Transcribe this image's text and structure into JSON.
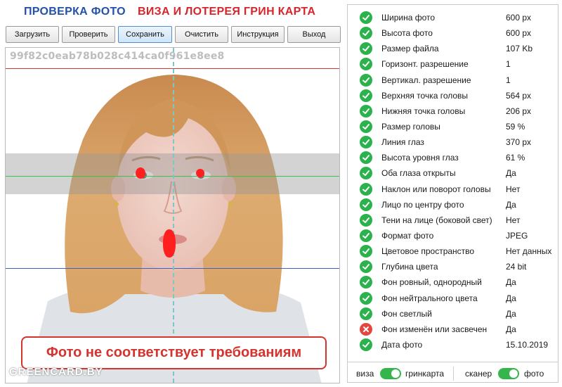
{
  "header": {
    "title_left": "ПРОВЕРКА ФОТО",
    "title_right": "ВИЗА И ЛОТЕРЕЯ ГРИН КАРТА"
  },
  "toolbar": {
    "buttons": [
      "Загрузить",
      "Проверить",
      "Сохранить",
      "Очистить",
      "Инструкция",
      "Выход"
    ],
    "active_button": "Сохранить"
  },
  "photo": {
    "hash": "99f82c0eab78b028c414ca0f961e8ee8",
    "result_message": "Фото не соответствует требованиям",
    "watermark": "GREENCARD.BY"
  },
  "checks": [
    {
      "label": "Ширина фото",
      "value": "600 px",
      "status": "ok"
    },
    {
      "label": "Высота фото",
      "value": "600 px",
      "status": "ok"
    },
    {
      "label": "Размер файла",
      "value": "107 Kb",
      "status": "ok"
    },
    {
      "label": "Горизонт. разрешение",
      "value": "1",
      "status": "ok"
    },
    {
      "label": "Вертикал. разрешение",
      "value": "1",
      "status": "ok"
    },
    {
      "label": "Верхняя точка головы",
      "value": "564 px",
      "status": "ok"
    },
    {
      "label": "Нижняя точка головы",
      "value": "206 px",
      "status": "ok"
    },
    {
      "label": "Размер головы",
      "value": "59 %",
      "status": "ok"
    },
    {
      "label": "Линия глаз",
      "value": "370 px",
      "status": "ok"
    },
    {
      "label": "Высота уровня глаз",
      "value": "61 %",
      "status": "ok"
    },
    {
      "label": "Оба глаза открыты",
      "value": "Да",
      "status": "ok"
    },
    {
      "label": "Наклон или поворот головы",
      "value": "Нет",
      "status": "ok"
    },
    {
      "label": "Лицо по центру фото",
      "value": "Да",
      "status": "ok"
    },
    {
      "label": "Тени на лице (боковой свет)",
      "value": "Нет",
      "status": "ok"
    },
    {
      "label": "Формат фото",
      "value": "JPEG",
      "status": "ok"
    },
    {
      "label": "Цветовое пространство",
      "value": "Нет данных",
      "status": "ok"
    },
    {
      "label": "Глубина цвета",
      "value": "24 bit",
      "status": "ok"
    },
    {
      "label": "Фон ровный, однородный",
      "value": "Да",
      "status": "ok"
    },
    {
      "label": "Фон нейтрального цвета",
      "value": "Да",
      "status": "ok"
    },
    {
      "label": "Фон светлый",
      "value": "Да",
      "status": "ok"
    },
    {
      "label": "Фон изменён или засвечен",
      "value": "Да",
      "status": "fail"
    },
    {
      "label": "Дата фото",
      "value": "15.10.2019",
      "status": "ok"
    }
  ],
  "footer": {
    "mode_left": "виза",
    "mode_right": "гринкарта",
    "source_left": "сканер",
    "source_right": "фото",
    "mode_toggle_on": true,
    "source_toggle_on": true
  },
  "colors": {
    "title_blue": "#2451a8",
    "title_red": "#d7262b",
    "ok": "#2bb24c",
    "fail": "#e4473f",
    "toggle_on": "#35b64d",
    "guide_top_red": "#d23a3a",
    "guide_eye_green": "#3cc24a",
    "guide_chin_blue": "#3f62c4"
  },
  "icons": {
    "ok": "check-circle-icon",
    "fail": "cross-circle-icon"
  }
}
